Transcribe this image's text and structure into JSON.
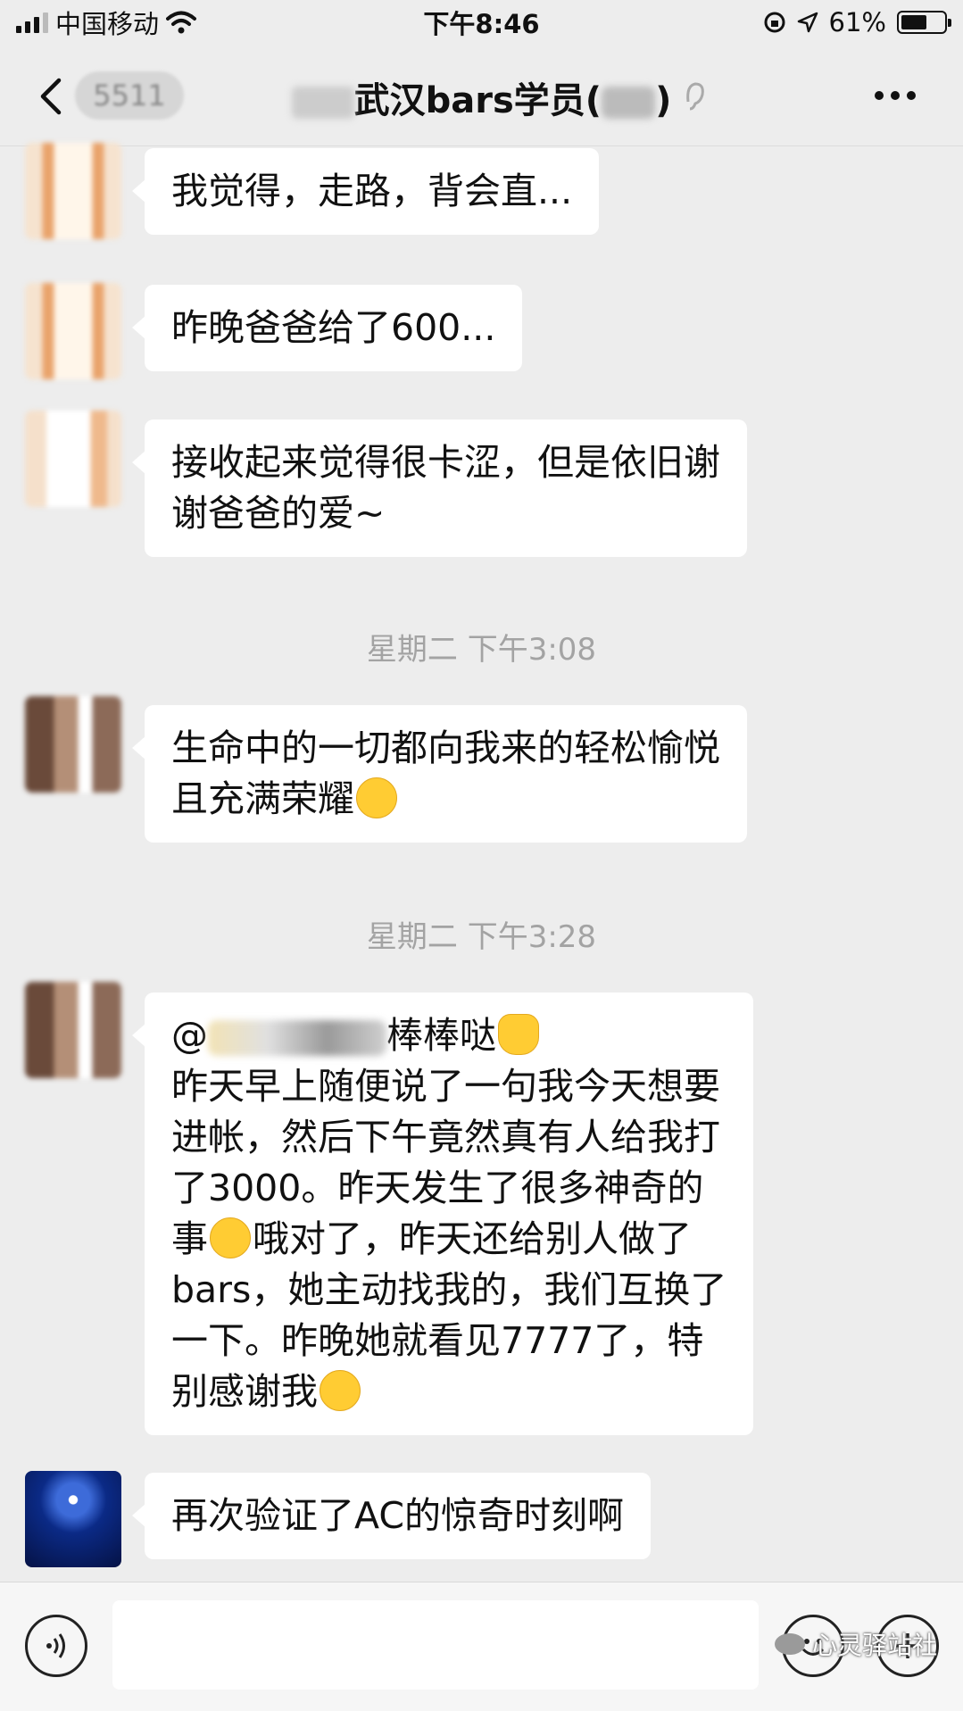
{
  "status_bar": {
    "carrier": "中国移动",
    "time": "下午8:46",
    "battery_percent": "61%",
    "battery_level": 0.61,
    "icons": [
      "signal-icon",
      "wifi-icon",
      "orientation-lock-icon",
      "location-icon",
      "battery-icon"
    ]
  },
  "nav": {
    "unread_count": "5511",
    "title": "武汉bars学员(",
    "title_suffix": ")",
    "icons": [
      "back-icon",
      "mute-icon",
      "more-icon"
    ]
  },
  "messages": [
    {
      "lines": [
        "我觉得，走路，背会直..."
      ]
    },
    {
      "lines": [
        "昨晚爸爸给了600..."
      ]
    },
    {
      "lines": [
        "接收起来觉得很卡涩，但是依旧谢",
        "谢爸爸的爱~"
      ]
    },
    {
      "timestamp": "星期二 下午3:08"
    },
    {
      "lines": [
        "生命中的一切都向我来的轻松愉悦",
        "且充满荣耀"
      ],
      "emoji": "smile-emoji"
    },
    {
      "timestamp": "星期二 下午3:28"
    },
    {
      "mention_prefix": "@",
      "mention_suffix": "棒棒哒",
      "lines": [
        "昨天早上随便说了一句我今天想要",
        "进帐，然后下午竟然真有人给我打",
        "了3000。昨天发生了很多神奇的",
        "哦对了，昨天还给别人做了",
        "bars，她主动找我的，我们互换了",
        "一下。昨晚她就看见7777了，特",
        "别感谢我"
      ],
      "line4_prefix": "事",
      "emojis": [
        "thumbs-up-emoji",
        "grin-emoji",
        "wink-tongue-emoji"
      ]
    },
    {
      "lines": [
        "再次验证了AC的惊奇时刻啊"
      ]
    }
  ],
  "input_bar": {
    "icons": [
      "voice-icon",
      "emoji-icon",
      "plus-icon"
    ],
    "watermark": "心灵驿站社"
  }
}
